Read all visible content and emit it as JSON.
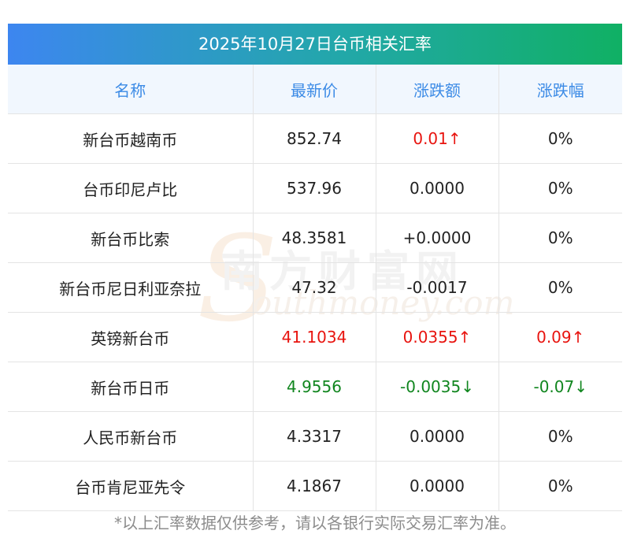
{
  "title": "2025年10月27日台币相关汇率",
  "headers": [
    "名称",
    "最新价",
    "涨跌额",
    "涨跌幅"
  ],
  "rows": [
    {
      "name": "新台币越南币",
      "price": "852.74",
      "change": "0.01↑",
      "pct": "0%",
      "price_trend": "",
      "change_trend": "up",
      "pct_trend": ""
    },
    {
      "name": "台币印尼卢比",
      "price": "537.96",
      "change": "0.0000",
      "pct": "0%",
      "price_trend": "",
      "change_trend": "",
      "pct_trend": ""
    },
    {
      "name": "新台币比索",
      "price": "48.3581",
      "change": "+0.0000",
      "pct": "0%",
      "price_trend": "",
      "change_trend": "",
      "pct_trend": ""
    },
    {
      "name": "新台币尼日利亚奈拉",
      "price": "47.32",
      "change": "-0.0017",
      "pct": "0%",
      "price_trend": "",
      "change_trend": "",
      "pct_trend": ""
    },
    {
      "name": "英镑新台币",
      "price": "41.1034",
      "change": "0.0355↑",
      "pct": "0.09↑",
      "price_trend": "up",
      "change_trend": "up",
      "pct_trend": "up"
    },
    {
      "name": "新台币日币",
      "price": "4.9556",
      "change": "-0.0035↓",
      "pct": "-0.07↓",
      "price_trend": "down",
      "change_trend": "down",
      "pct_trend": "down"
    },
    {
      "name": "人民币新台币",
      "price": "4.3317",
      "change": "0.0000",
      "pct": "0%",
      "price_trend": "",
      "change_trend": "",
      "pct_trend": ""
    },
    {
      "name": "台币肯尼亚先令",
      "price": "4.1867",
      "change": "0.0000",
      "pct": "0%",
      "price_trend": "",
      "change_trend": "",
      "pct_trend": ""
    }
  ],
  "watermark": {
    "logo_letter": "S",
    "chinese": "南方财富网",
    "english": "outhmoney.com"
  },
  "footnote": "*以上汇率数据仅供参考，请以各银行实际交易汇率为准。",
  "colors": {
    "up": "#e8140f",
    "down": "#11861f",
    "header_text": "#3c8be6",
    "gradient_start": "#3d86f0",
    "gradient_end": "#10b064"
  }
}
